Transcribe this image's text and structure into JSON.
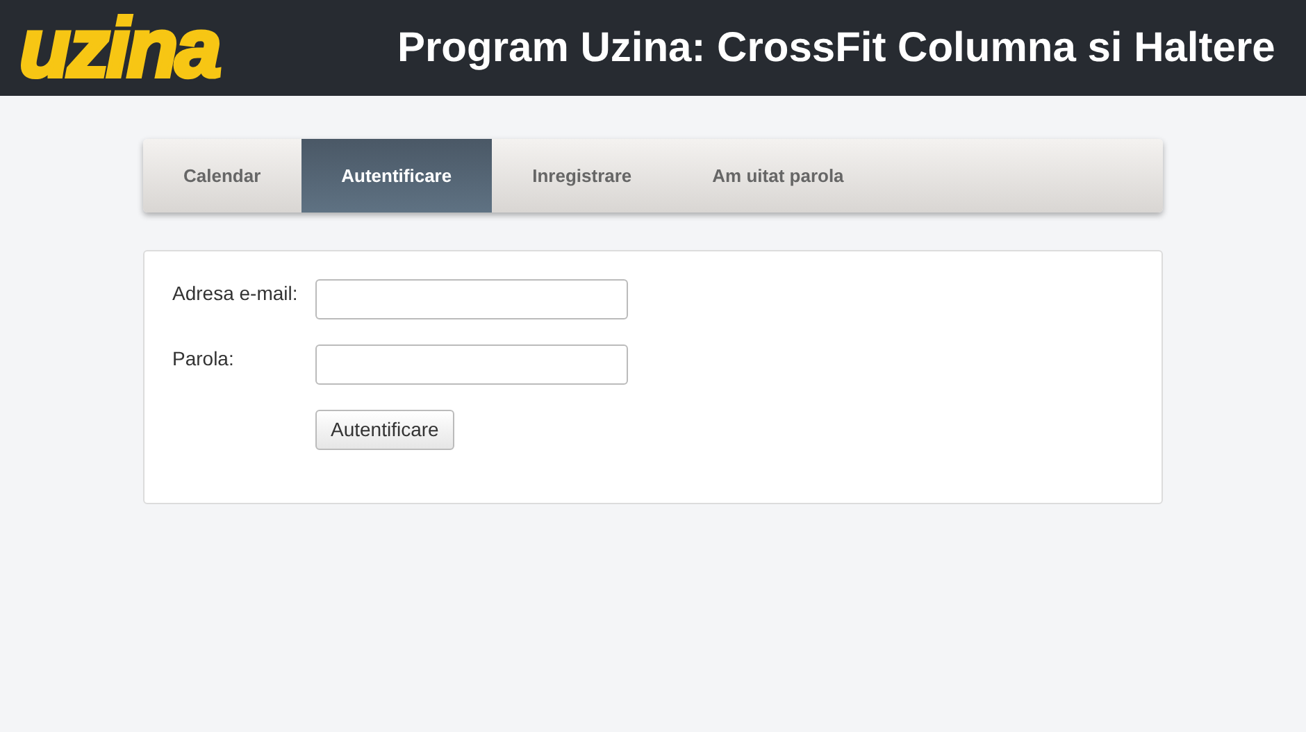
{
  "header": {
    "logo": "uzina",
    "title": "Program Uzina: CrossFit Columna si Haltere"
  },
  "tabs": [
    {
      "label": "Calendar",
      "selected": false
    },
    {
      "label": "Autentificare",
      "selected": true
    },
    {
      "label": "Inregistrare",
      "selected": false
    },
    {
      "label": "Am uitat parola",
      "selected": false
    }
  ],
  "form": {
    "fields": [
      {
        "label": "Adresa e-mail:"
      },
      {
        "label": "Parola:"
      }
    ],
    "submit": "Autentificare"
  }
}
